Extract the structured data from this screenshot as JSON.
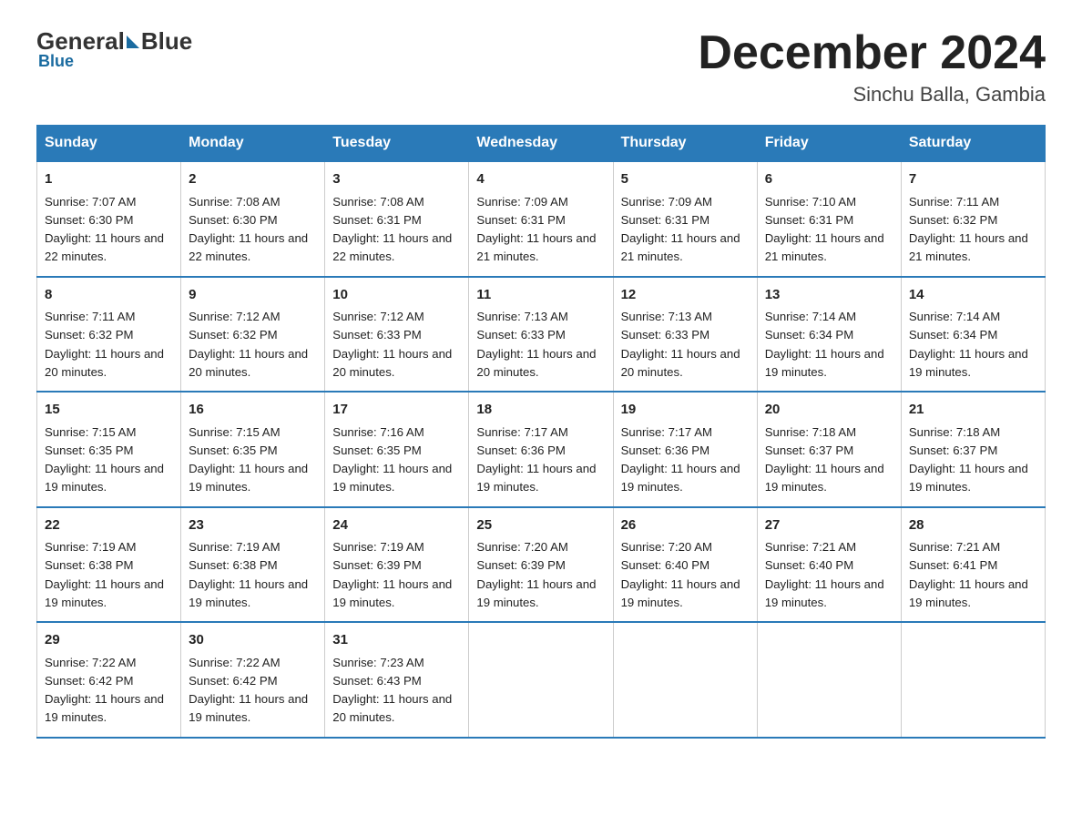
{
  "logo": {
    "general": "General",
    "blue": "Blue"
  },
  "header": {
    "month": "December 2024",
    "location": "Sinchu Balla, Gambia"
  },
  "weekdays": [
    "Sunday",
    "Monday",
    "Tuesday",
    "Wednesday",
    "Thursday",
    "Friday",
    "Saturday"
  ],
  "weeks": [
    [
      {
        "day": "1",
        "sunrise": "7:07 AM",
        "sunset": "6:30 PM",
        "daylight": "11 hours and 22 minutes."
      },
      {
        "day": "2",
        "sunrise": "7:08 AM",
        "sunset": "6:30 PM",
        "daylight": "11 hours and 22 minutes."
      },
      {
        "day": "3",
        "sunrise": "7:08 AM",
        "sunset": "6:31 PM",
        "daylight": "11 hours and 22 minutes."
      },
      {
        "day": "4",
        "sunrise": "7:09 AM",
        "sunset": "6:31 PM",
        "daylight": "11 hours and 21 minutes."
      },
      {
        "day": "5",
        "sunrise": "7:09 AM",
        "sunset": "6:31 PM",
        "daylight": "11 hours and 21 minutes."
      },
      {
        "day": "6",
        "sunrise": "7:10 AM",
        "sunset": "6:31 PM",
        "daylight": "11 hours and 21 minutes."
      },
      {
        "day": "7",
        "sunrise": "7:11 AM",
        "sunset": "6:32 PM",
        "daylight": "11 hours and 21 minutes."
      }
    ],
    [
      {
        "day": "8",
        "sunrise": "7:11 AM",
        "sunset": "6:32 PM",
        "daylight": "11 hours and 20 minutes."
      },
      {
        "day": "9",
        "sunrise": "7:12 AM",
        "sunset": "6:32 PM",
        "daylight": "11 hours and 20 minutes."
      },
      {
        "day": "10",
        "sunrise": "7:12 AM",
        "sunset": "6:33 PM",
        "daylight": "11 hours and 20 minutes."
      },
      {
        "day": "11",
        "sunrise": "7:13 AM",
        "sunset": "6:33 PM",
        "daylight": "11 hours and 20 minutes."
      },
      {
        "day": "12",
        "sunrise": "7:13 AM",
        "sunset": "6:33 PM",
        "daylight": "11 hours and 20 minutes."
      },
      {
        "day": "13",
        "sunrise": "7:14 AM",
        "sunset": "6:34 PM",
        "daylight": "11 hours and 19 minutes."
      },
      {
        "day": "14",
        "sunrise": "7:14 AM",
        "sunset": "6:34 PM",
        "daylight": "11 hours and 19 minutes."
      }
    ],
    [
      {
        "day": "15",
        "sunrise": "7:15 AM",
        "sunset": "6:35 PM",
        "daylight": "11 hours and 19 minutes."
      },
      {
        "day": "16",
        "sunrise": "7:15 AM",
        "sunset": "6:35 PM",
        "daylight": "11 hours and 19 minutes."
      },
      {
        "day": "17",
        "sunrise": "7:16 AM",
        "sunset": "6:35 PM",
        "daylight": "11 hours and 19 minutes."
      },
      {
        "day": "18",
        "sunrise": "7:17 AM",
        "sunset": "6:36 PM",
        "daylight": "11 hours and 19 minutes."
      },
      {
        "day": "19",
        "sunrise": "7:17 AM",
        "sunset": "6:36 PM",
        "daylight": "11 hours and 19 minutes."
      },
      {
        "day": "20",
        "sunrise": "7:18 AM",
        "sunset": "6:37 PM",
        "daylight": "11 hours and 19 minutes."
      },
      {
        "day": "21",
        "sunrise": "7:18 AM",
        "sunset": "6:37 PM",
        "daylight": "11 hours and 19 minutes."
      }
    ],
    [
      {
        "day": "22",
        "sunrise": "7:19 AM",
        "sunset": "6:38 PM",
        "daylight": "11 hours and 19 minutes."
      },
      {
        "day": "23",
        "sunrise": "7:19 AM",
        "sunset": "6:38 PM",
        "daylight": "11 hours and 19 minutes."
      },
      {
        "day": "24",
        "sunrise": "7:19 AM",
        "sunset": "6:39 PM",
        "daylight": "11 hours and 19 minutes."
      },
      {
        "day": "25",
        "sunrise": "7:20 AM",
        "sunset": "6:39 PM",
        "daylight": "11 hours and 19 minutes."
      },
      {
        "day": "26",
        "sunrise": "7:20 AM",
        "sunset": "6:40 PM",
        "daylight": "11 hours and 19 minutes."
      },
      {
        "day": "27",
        "sunrise": "7:21 AM",
        "sunset": "6:40 PM",
        "daylight": "11 hours and 19 minutes."
      },
      {
        "day": "28",
        "sunrise": "7:21 AM",
        "sunset": "6:41 PM",
        "daylight": "11 hours and 19 minutes."
      }
    ],
    [
      {
        "day": "29",
        "sunrise": "7:22 AM",
        "sunset": "6:42 PM",
        "daylight": "11 hours and 19 minutes."
      },
      {
        "day": "30",
        "sunrise": "7:22 AM",
        "sunset": "6:42 PM",
        "daylight": "11 hours and 19 minutes."
      },
      {
        "day": "31",
        "sunrise": "7:23 AM",
        "sunset": "6:43 PM",
        "daylight": "11 hours and 20 minutes."
      },
      null,
      null,
      null,
      null
    ]
  ],
  "labels": {
    "sunrise": "Sunrise: ",
    "sunset": "Sunset: ",
    "daylight": "Daylight: "
  }
}
